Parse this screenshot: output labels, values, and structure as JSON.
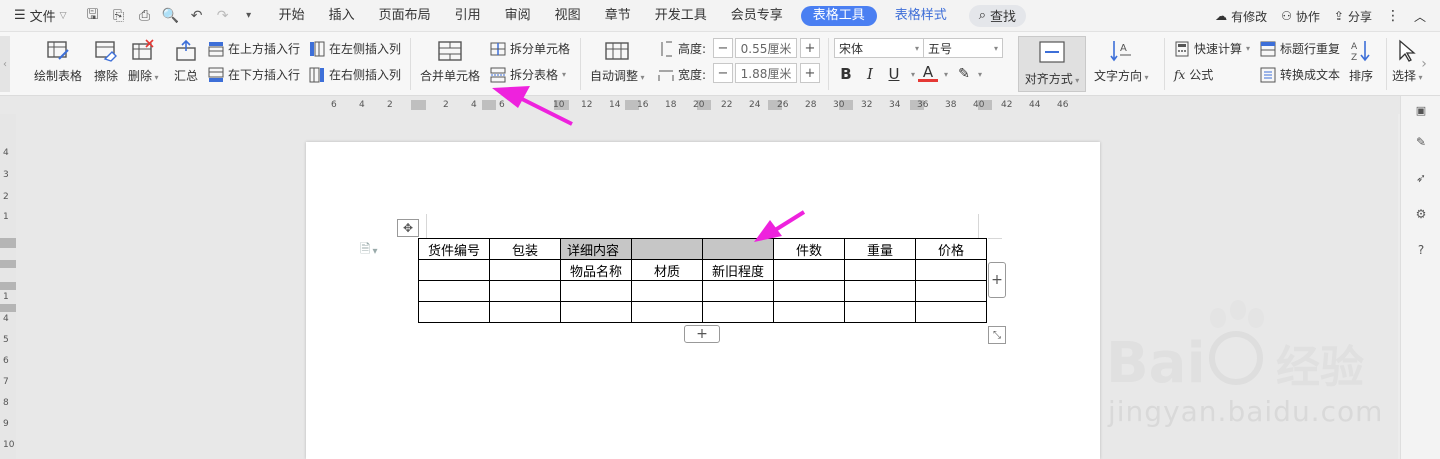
{
  "menubar": {
    "file_label": "文件",
    "tabs": [
      {
        "label": "开始"
      },
      {
        "label": "插入"
      },
      {
        "label": "页面布局"
      },
      {
        "label": "引用"
      },
      {
        "label": "审阅"
      },
      {
        "label": "视图"
      },
      {
        "label": "章节"
      },
      {
        "label": "开发工具"
      },
      {
        "label": "会员专享"
      },
      {
        "label": "表格工具"
      },
      {
        "label": "表格样式"
      }
    ],
    "search_label": "查找",
    "right": {
      "modified": "有修改",
      "collab": "协作",
      "share": "分享"
    }
  },
  "ribbon": {
    "draw_table": "绘制表格",
    "erase": "擦除",
    "delete": "删除",
    "summary": "汇总",
    "insert_above": "在上方插入行",
    "insert_below": "在下方插入行",
    "insert_left": "在左侧插入列",
    "insert_right": "在右侧插入列",
    "merge_cells": "合并单元格",
    "split_cells": "拆分单元格",
    "split_table": "拆分表格",
    "auto_fit": "自动调整",
    "height_label": "高度:",
    "height_value": "0.55厘米",
    "width_label": "宽度:",
    "width_value": "1.88厘米",
    "font_name": "宋体",
    "font_size": "五号",
    "align": "对齐方式",
    "text_direction": "文字方向",
    "quick_calc": "快速计算",
    "header_repeat": "标题行重复",
    "formula": "公式",
    "convert_text": "转换成文本",
    "sort": "排序",
    "select": "选择"
  },
  "ruler": {
    "h_numbers": [
      "6",
      "4",
      "2",
      "2",
      "4",
      "6",
      "10",
      "12",
      "14",
      "16",
      "18",
      "20",
      "22",
      "24",
      "26",
      "28",
      "30",
      "32",
      "34",
      "36",
      "38",
      "40",
      "42",
      "44",
      "46"
    ],
    "v_numbers": [
      "4",
      "3",
      "2",
      "1",
      "1",
      "4",
      "5",
      "6",
      "7",
      "8",
      "9",
      "10"
    ]
  },
  "table": {
    "rows": [
      [
        "货件编号",
        "包装",
        "详细内容",
        "",
        "",
        "件数",
        "重量",
        "价格"
      ],
      [
        "",
        "",
        "物品名称",
        "材质",
        "新旧程度",
        "",
        "",
        ""
      ],
      [
        "",
        "",
        "",
        "",
        "",
        "",
        "",
        ""
      ],
      [
        "",
        "",
        "",
        "",
        "",
        "",
        "",
        ""
      ]
    ]
  },
  "watermark": {
    "text": "jingyan.baidu.com"
  },
  "colors": {
    "accent": "#4a7ff2",
    "arrow": "#ee22dd",
    "selection": "#c6c6c6"
  }
}
